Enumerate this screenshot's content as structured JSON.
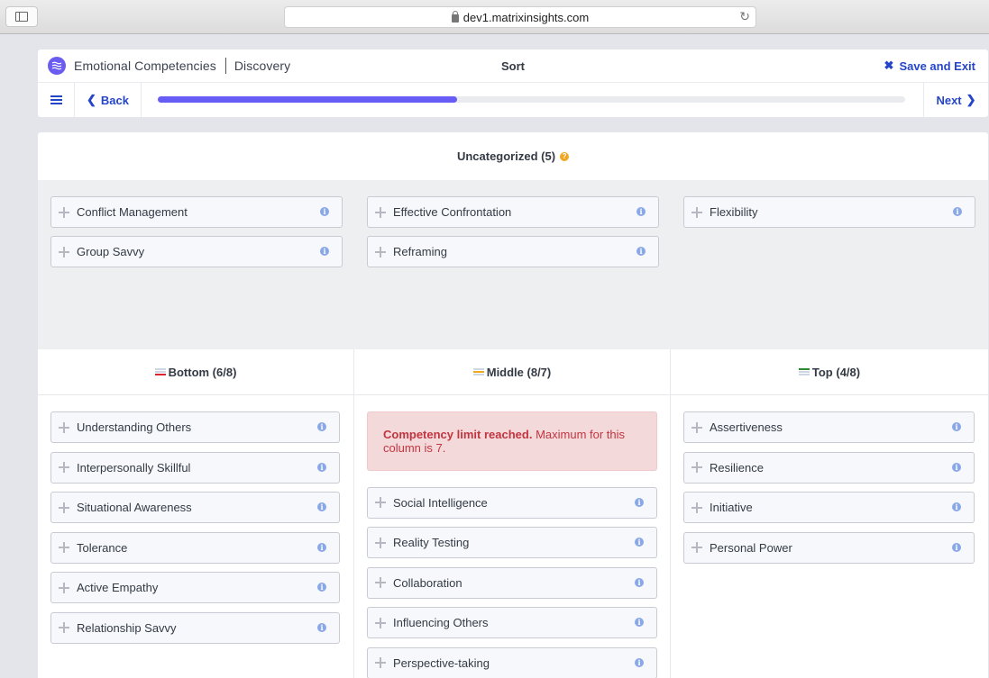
{
  "browser": {
    "url": "dev1.matrixinsights.com",
    "icons": {
      "sidebar": "sidebar-toggle-icon",
      "lock": "lock-icon",
      "reload": "reload-icon"
    }
  },
  "header": {
    "app_name": "Emotional Competencies",
    "section": "Discovery",
    "page_title": "Sort",
    "save_exit_label": "Save and Exit",
    "back_label": "Back",
    "next_label": "Next",
    "progress_percent": 40,
    "accent_color": "#675cf5",
    "link_color": "#2545c8"
  },
  "uncategorized": {
    "title": "Uncategorized (5)",
    "columns": [
      [
        "Conflict Management",
        "Group Savvy"
      ],
      [
        "Effective Confrontation",
        "Reframing"
      ],
      [
        "Flexibility"
      ]
    ]
  },
  "columns": [
    {
      "key": "bottom",
      "title": "Bottom (6/8)",
      "indicator_color": "#d9262c",
      "items": [
        "Understanding Others",
        "Interpersonally Skillful",
        "Situational Awareness",
        "Tolerance",
        "Active Empathy",
        "Relationship Savvy"
      ]
    },
    {
      "key": "middle",
      "title": "Middle (8/7)",
      "indicator_color": "#f2a81d",
      "alert": {
        "strong": "Competency limit reached.",
        "text": " Maximum for this column is 7."
      },
      "items": [
        "Social Intelligence",
        "Reality Testing",
        "Collaboration",
        "Influencing Others",
        "Perspective-taking"
      ]
    },
    {
      "key": "top",
      "title": "Top (4/8)",
      "indicator_color": "#2e8b2e",
      "items": [
        "Assertiveness",
        "Resilience",
        "Initiative",
        "Personal Power"
      ]
    }
  ]
}
